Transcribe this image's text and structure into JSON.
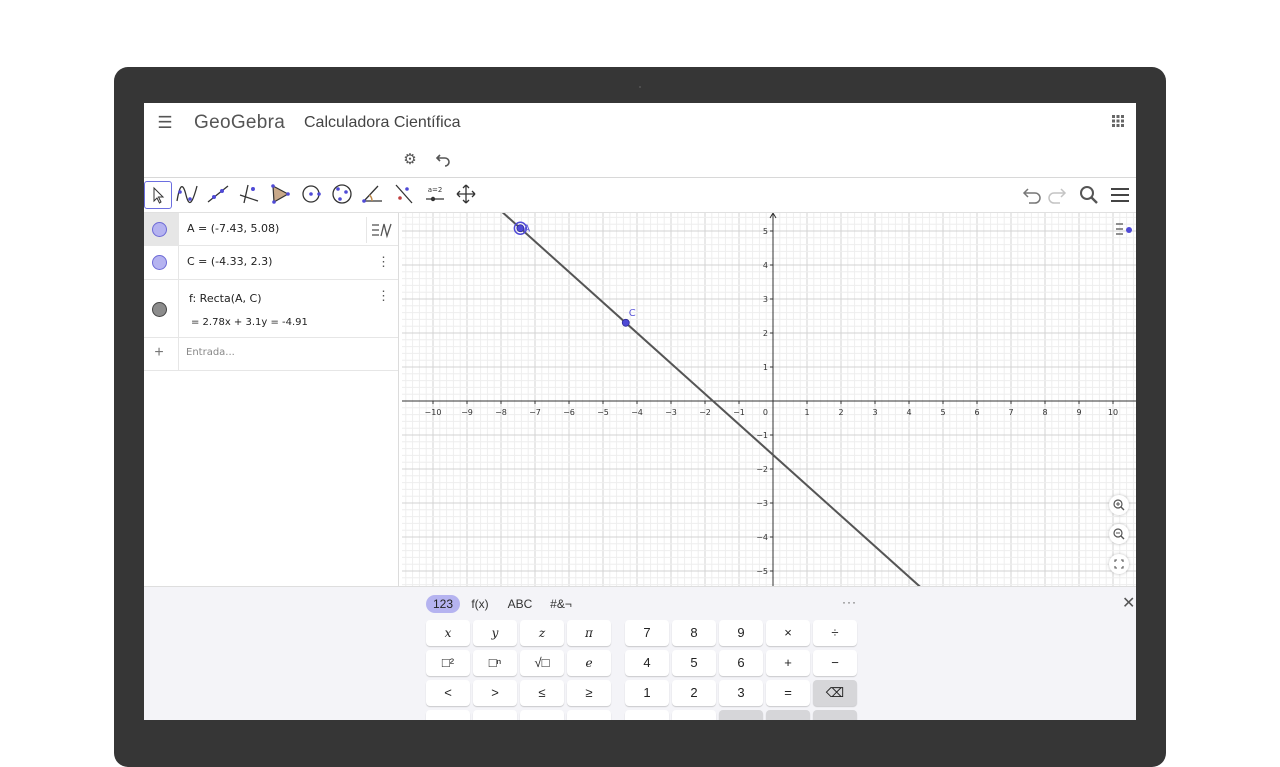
{
  "header": {
    "logo": "GeoGebra",
    "title": "Calculadora Científica"
  },
  "algebra": {
    "items": [
      {
        "label": "A = (-7.43, 5.08)"
      },
      {
        "label": "C = (-4.33, 2.3)"
      },
      {
        "label": "f: Recta(A, C)",
        "value": "=  2.78x + 3.1y = -4.91"
      }
    ],
    "input_placeholder": "Entrada..."
  },
  "graphics": {
    "x_range": [
      -11,
      10.7
    ],
    "y_range": [
      -5.5,
      5.6
    ],
    "x_ticks": [
      -10,
      -9,
      -8,
      -7,
      -6,
      -5,
      -4,
      -3,
      -2,
      -1,
      1,
      2,
      3,
      4,
      5,
      6,
      7,
      8,
      9,
      10
    ],
    "y_ticks": [
      -5,
      -4,
      -3,
      -2,
      -1,
      1,
      2,
      3,
      4,
      5
    ],
    "origin_label": "0",
    "point_A": {
      "label": "A",
      "x": -7.43,
      "y": 5.08
    },
    "point_C": {
      "label": "C",
      "x": -4.33,
      "y": 2.3
    },
    "line": {
      "a": 2.78,
      "b": 3.1,
      "c": -4.91
    },
    "colors": {
      "point": "#4f4ad6",
      "point_label": "#5b57d8",
      "line": "#555555",
      "axis": "#333333"
    }
  },
  "keyboard": {
    "tabs": [
      "123",
      "f(x)",
      "ABC",
      "#&¬"
    ],
    "more": "···",
    "close": "✕",
    "rows": [
      [
        "x",
        "y",
        "z",
        "π",
        "7",
        "8",
        "9",
        "×",
        "÷"
      ],
      [
        "□²",
        "□ⁿ",
        "√□",
        "e",
        "4",
        "5",
        "6",
        "+",
        "−"
      ],
      [
        "<",
        ">",
        "≤",
        "≥",
        "1",
        "2",
        "3",
        "=",
        "⌫"
      ]
    ]
  }
}
